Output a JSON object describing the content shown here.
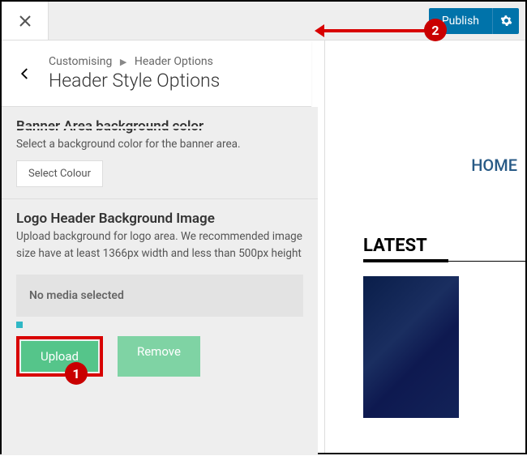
{
  "top": {
    "publish_label": "Publish"
  },
  "crumbs": {
    "root": "Customising",
    "parent": "Header Options",
    "title": "Header Style Options"
  },
  "section1": {
    "heading": "Banner Area background color",
    "desc": "Select a background color for the banner area.",
    "button": "Select Colour"
  },
  "section2": {
    "heading": "Logo Header Background Image",
    "desc": "Upload background for logo area. We recommended image size have at least 1366px width and less than 500px height",
    "placeholder": "No media selected",
    "upload": "Upload",
    "remove": "Remove"
  },
  "preview": {
    "home": "HOME",
    "latest": "LATEST"
  },
  "callouts": {
    "one": "1",
    "two": "2"
  }
}
